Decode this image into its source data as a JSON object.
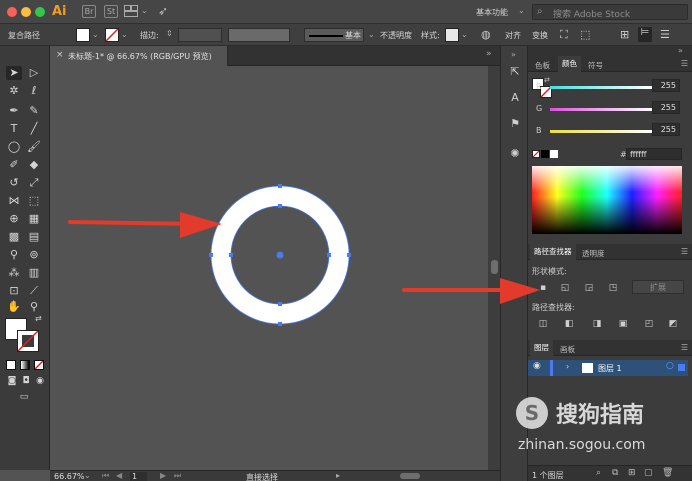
{
  "app": {
    "logo": "Ai",
    "workspace": "基本功能",
    "search_placeholder": "搜索 Adobe Stock"
  },
  "control": {
    "selection_type": "复合路径",
    "stroke_label": "描边:",
    "brush_label": "基本",
    "opacity_label": "不透明度",
    "style_label": "样式:",
    "align_label": "对齐",
    "transform_label": "变换"
  },
  "document": {
    "tab_title": "未标题-1* @ 66.67% (RGB/GPU 预览)"
  },
  "status": {
    "zoom": "66.67%",
    "page": "1",
    "tool_name": "直接选择"
  },
  "color_panel": {
    "tabs": [
      "色板",
      "颜色",
      "符号"
    ],
    "active_tab": "颜色",
    "channels": [
      {
        "name": "R",
        "value": "255",
        "color": "#ff4b4b"
      },
      {
        "name": "G",
        "value": "255",
        "color": "#e05ad8"
      },
      {
        "name": "B",
        "value": "255",
        "color": "#e8e04a"
      }
    ],
    "hex_prefix": "#",
    "hex": "ffffff"
  },
  "pathfinder": {
    "tabs": [
      "路径查找器",
      "透明度"
    ],
    "shape_modes_label": "形状模式:",
    "expand_label": "扩展",
    "pathfinders_label": "路径查找器:"
  },
  "layers": {
    "tabs": [
      "图层",
      "画板"
    ],
    "layer_name": "图层 1",
    "count": "1 个图层"
  },
  "watermark": {
    "brand": "搜狗指南",
    "domain": "zhinan.sogou.com"
  },
  "colors": {
    "arrow": "#e23a2b",
    "selection": "#4a7cf0",
    "panel": "#3c3c3c",
    "canvas": "#535353"
  }
}
